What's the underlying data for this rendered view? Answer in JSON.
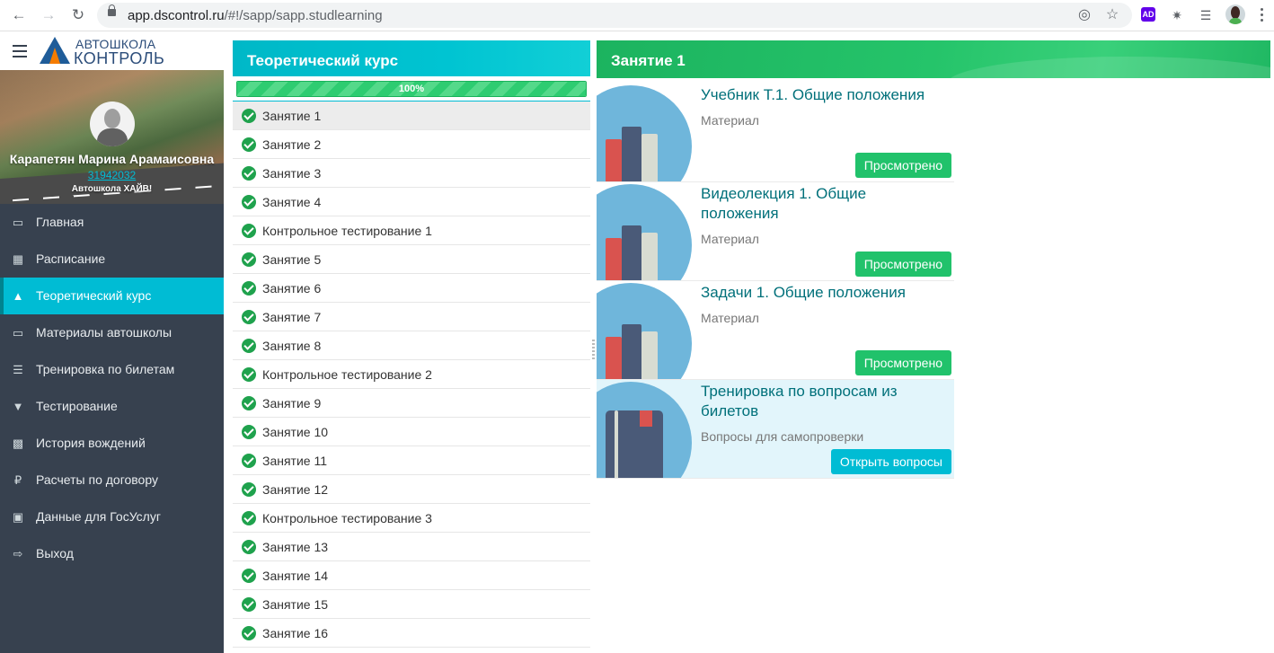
{
  "browser": {
    "url_host": "app.dscontrol.ru",
    "url_path": "/#!/sapp/sapp.studlearning",
    "ext_ad": "AD"
  },
  "brand": {
    "line1": "АВТОШКОЛА",
    "line2": "КОНТРОЛЬ"
  },
  "user": {
    "name": "Карапетян Марина Арамаисовна",
    "id": "31942032",
    "school": "Автошкола ХАЙВ!"
  },
  "menu": [
    {
      "label": "Главная",
      "icon": "monitor-icon"
    },
    {
      "label": "Расписание",
      "icon": "calendar-icon"
    },
    {
      "label": "Теоретический курс",
      "icon": "graduation-cap-icon",
      "active": true
    },
    {
      "label": "Материалы автошколы",
      "icon": "book-icon"
    },
    {
      "label": "Тренировка по билетам",
      "icon": "list-icon"
    },
    {
      "label": "Тестирование",
      "icon": "trophy-icon"
    },
    {
      "label": "История вождений",
      "icon": "car-icon"
    },
    {
      "label": "Расчеты по договору",
      "icon": "ruble-icon"
    },
    {
      "label": "Данные для ГосУслуг",
      "icon": "bank-icon"
    },
    {
      "label": "Выход",
      "icon": "sign-out-icon"
    }
  ],
  "course": {
    "title": "Теоретический курс",
    "progress_label": "100%",
    "progress_value": 1.0,
    "lessons": [
      "Занятие 1",
      "Занятие 2",
      "Занятие 3",
      "Занятие 4",
      "Контрольное тестирование 1",
      "Занятие 5",
      "Занятие 6",
      "Занятие 7",
      "Занятие 8",
      "Контрольное тестирование 2",
      "Занятие 9",
      "Занятие 10",
      "Занятие 11",
      "Занятие 12",
      "Контрольное тестирование 3",
      "Занятие 13",
      "Занятие 14",
      "Занятие 15",
      "Занятие 16"
    ]
  },
  "lesson_panel": {
    "title": "Занятие 1",
    "cards": [
      {
        "title": "Учебник Т.1. Общие положения",
        "subtitle": "Материал",
        "button": "Просмотрено",
        "icon": "books-icon"
      },
      {
        "title": "Видеолекция 1. Общие положения",
        "subtitle": "Материал",
        "button": "Просмотрено",
        "icon": "books-icon"
      },
      {
        "title": "Задачи 1. Общие положения",
        "subtitle": "Материал",
        "button": "Просмотрено",
        "icon": "books-icon"
      },
      {
        "title": "Тренировка по вопросам из билетов",
        "subtitle": "Вопросы для самопроверки",
        "button": "Открыть вопросы",
        "icon": "notebook-icon"
      }
    ]
  },
  "colors": {
    "sidebar_bg": "#37414f",
    "accent_cyan": "#00bcd4",
    "accent_green": "#21c26b",
    "title_teal": "#00707a"
  }
}
